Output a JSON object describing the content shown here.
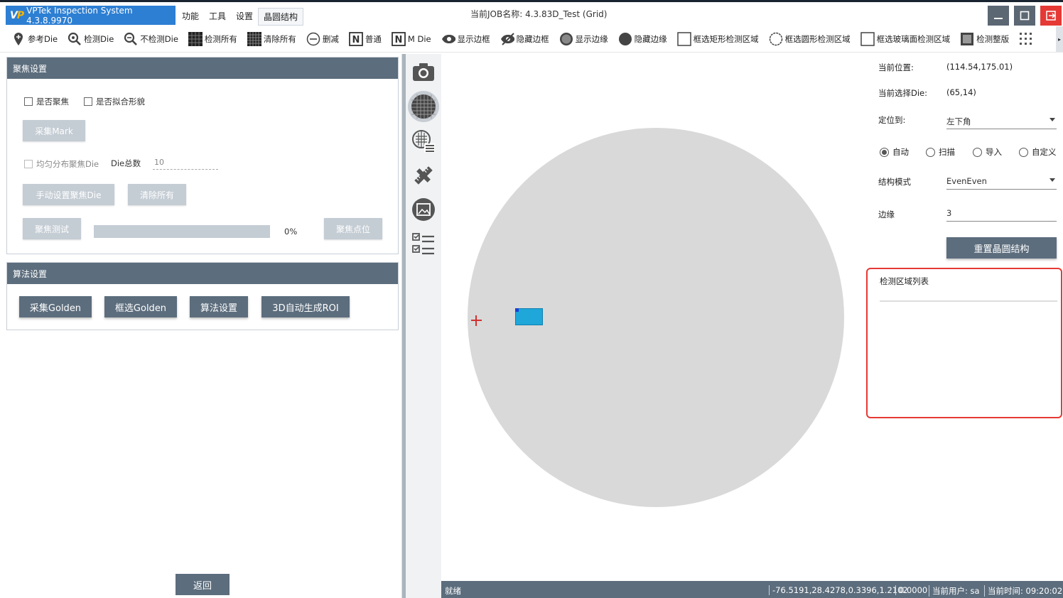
{
  "app": {
    "title": "VPTek Inspection System 4.3.8.9970"
  },
  "menu": [
    "功能",
    "工具",
    "设置",
    "晶圆结构"
  ],
  "job_title": "当前JOB名称:  4.3.83D_Test (Grid)",
  "toolbar": {
    "items": [
      "参考Die",
      "检测Die",
      "不检测Die",
      "检测所有",
      "清除所有",
      "删减",
      "普通",
      "M Die",
      "显示边框",
      "隐藏边框",
      "显示边缘",
      "隐藏边缘",
      "框选矩形检测区域",
      "框选圆形检测区域",
      "框选玻璃面检测区域",
      "检测整版"
    ]
  },
  "focus": {
    "header": "聚焦设置",
    "chk_focus": "是否聚焦",
    "chk_fit": "是否拟合形貌",
    "btn_capture_mark": "采集Mark",
    "chk_uniform": "均匀分布聚焦Die",
    "die_count_label": "Die总数",
    "die_count_value": "10",
    "btn_manual": "手动设置聚焦Die",
    "btn_clear": "清除所有",
    "btn_test": "聚焦测试",
    "progress": 0,
    "progress_text": "0%",
    "btn_locate": "聚焦点位"
  },
  "algo": {
    "header": "算法设置",
    "btn_capture_golden": "采集Golden",
    "btn_select_golden": "框选Golden",
    "btn_algo_settings": "算法设置",
    "btn_auto_roi": "3D自动生成ROI"
  },
  "return_label": "返回",
  "right": {
    "pos_label": "当前位置:",
    "pos_value": "(114.54,175.01)",
    "die_label": "当前选择Die:",
    "die_value": "(65,14)",
    "locate_label": "定位到:",
    "locate_value": "左下角",
    "radios": [
      "自动",
      "扫描",
      "导入",
      "自定义"
    ],
    "radio_selected": "自动",
    "mode_label": "结构模式",
    "mode_value": "EvenEven",
    "edge_label": "边缘",
    "edge_value": "3",
    "reset_btn": "重置晶圆结构",
    "roi_list_title": "检测区域列表"
  },
  "status": {
    "ready": "就绪",
    "coords": "-76.5191,28.4278,0.3396,1.2102",
    "val": "0.0000",
    "user": "当前用户:  sa",
    "time": "当前时间:  09:20:02"
  },
  "colors": {
    "accent": "#5c6d7d",
    "brand": "#2d7fd3",
    "highlight": "#e53935",
    "die": "#1ea7d8"
  }
}
